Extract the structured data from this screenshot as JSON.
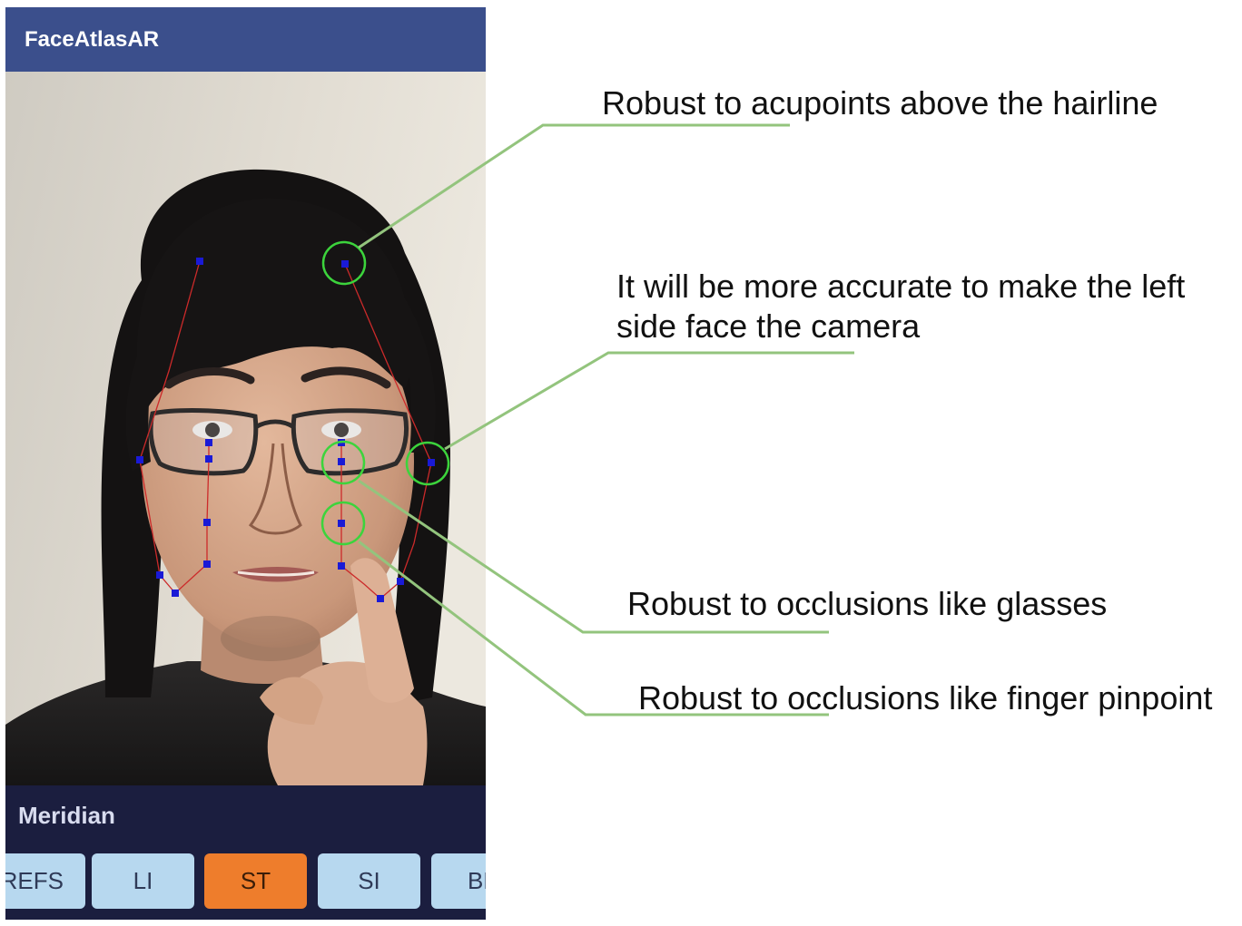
{
  "app": {
    "title": "FaceAtlasAR"
  },
  "panel": {
    "label": "Meridian",
    "chips": [
      {
        "label": "REFS",
        "active": false
      },
      {
        "label": "LI",
        "active": false
      },
      {
        "label": "ST",
        "active": true
      },
      {
        "label": "SI",
        "active": false
      },
      {
        "label": "BL",
        "active": false
      }
    ]
  },
  "annotations": {
    "hairline": "Robust to acupoints above the hairline",
    "left_side_line1": "It will be more accurate to make the left",
    "left_side_line2": "side face the camera",
    "glasses": "Robust to occlusions like glasses",
    "finger": "Robust to occlusions like finger pinpoint"
  },
  "colors": {
    "appbar": "#3b4f8c",
    "panel": "#1b1e3f",
    "chip": "#b7d8ef",
    "chip_active": "#ee7d2c",
    "callout_line": "#93c47d",
    "highlight_circle": "#3cd43c",
    "landmark": "#1a1ad6",
    "meridian_line": "#cc2a2a"
  }
}
